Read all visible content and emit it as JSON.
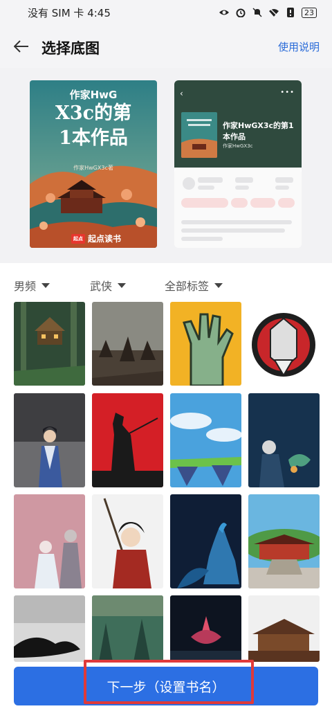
{
  "status_bar": {
    "carrier_time": "没有 SIM 卡 4:45",
    "battery": "23",
    "icons": [
      "eye-icon",
      "alarm-icon",
      "mute-icon",
      "wifi-off-icon",
      "alert-icon",
      "battery-icon"
    ]
  },
  "header": {
    "title": "选择底图",
    "help_label": "使用说明",
    "back_icon": "back-arrow-icon"
  },
  "preview": {
    "cover": {
      "author": "作家HwG",
      "title_line1": "X3c的第",
      "title_line2": "1本作品",
      "subtitle": "作家HwGX3c著",
      "brand_badge": "起点",
      "brand_name": "起点读书"
    },
    "mockup": {
      "book_title": "作家HwGX3c的第1本作品",
      "author": "作家HwGX3c"
    }
  },
  "filters": [
    {
      "label": "男频"
    },
    {
      "label": "武侠"
    },
    {
      "label": "全部标签"
    }
  ],
  "grid": {
    "tiles": [
      "treehouse-forest",
      "warriors-battle",
      "zombie-hand",
      "warrior-mask",
      "swordsman-gray",
      "samurai-red",
      "sky-island",
      "old-man-dragon",
      "ancient-beauty",
      "warrior-spear",
      "peacock-night",
      "chinese-temple",
      "dragon-ink",
      "misty-forest",
      "lotus-dark",
      "palace-silhouette"
    ]
  },
  "next_button": {
    "label": "下一步（设置书名）"
  },
  "colors": {
    "accent": "#2c6fe3",
    "link": "#2a6bd8",
    "highlight": "#e03a3a"
  }
}
